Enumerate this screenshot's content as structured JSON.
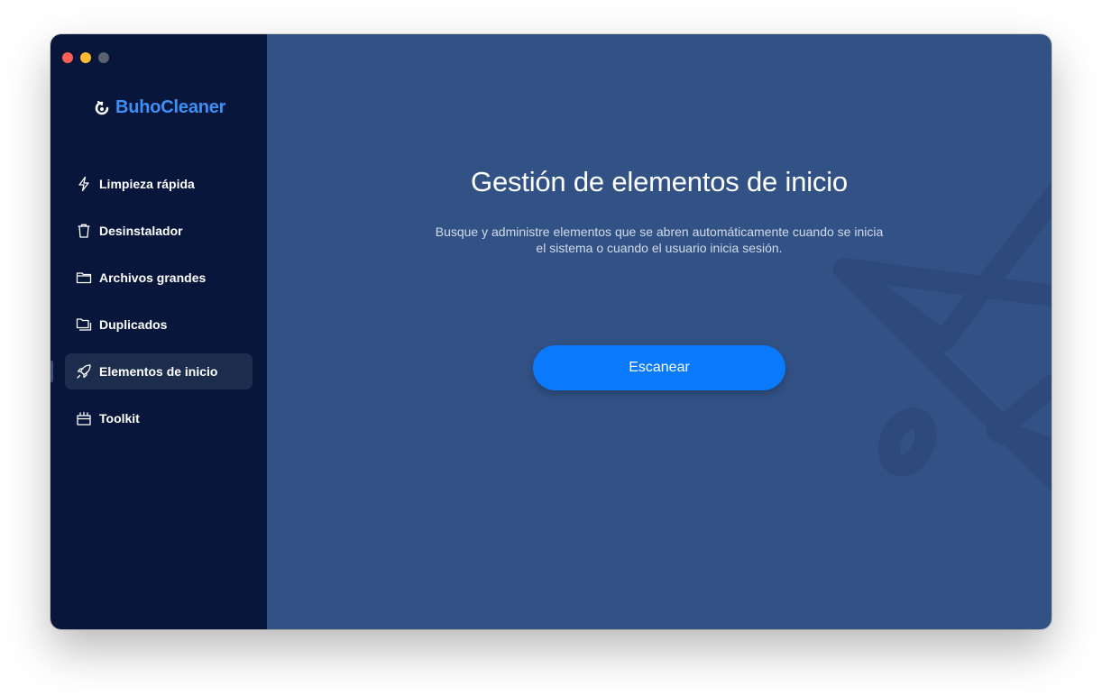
{
  "app": {
    "name": "BuhoCleaner",
    "brand_color": "#3e8ff6"
  },
  "window_controls": [
    "close",
    "minimize",
    "zoom"
  ],
  "sidebar": {
    "items": [
      {
        "label": "Limpieza rápida",
        "icon": "bolt-icon",
        "active": false
      },
      {
        "label": "Desinstalador",
        "icon": "trash-icon",
        "active": false
      },
      {
        "label": "Archivos grandes",
        "icon": "folder-icon",
        "active": false
      },
      {
        "label": "Duplicados",
        "icon": "duplicate-folder-icon",
        "active": false
      },
      {
        "label": "Elementos de inicio",
        "icon": "rocket-icon",
        "active": true
      },
      {
        "label": "Toolkit",
        "icon": "toolkit-icon",
        "active": false
      }
    ]
  },
  "main": {
    "title": "Gestión de elementos de inicio",
    "description_line1": "Busque y administre elementos que se abren automáticamente cuando se inicia",
    "description_line2": "el sistema o cuando el usuario inicia sesión.",
    "scan_button": "Escanear"
  },
  "colors": {
    "sidebar_bg": "#07163a",
    "main_bg": "#325286",
    "button_bg": "#0a7afd"
  }
}
